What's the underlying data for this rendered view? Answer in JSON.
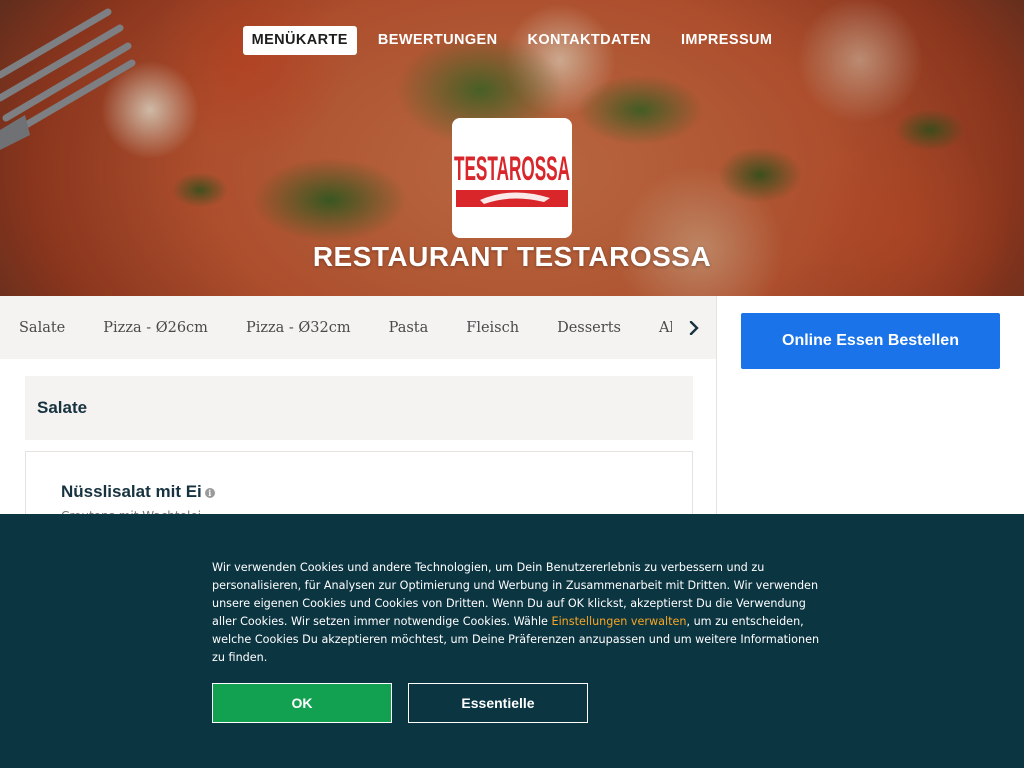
{
  "nav": {
    "items": [
      {
        "label": "MENÜKARTE",
        "active": true
      },
      {
        "label": "BEWERTUNGEN",
        "active": false
      },
      {
        "label": "KONTAKTDATEN",
        "active": false
      },
      {
        "label": "IMPRESSUM",
        "active": false
      }
    ]
  },
  "logo": {
    "text": "TESTAROSSA"
  },
  "restaurant": {
    "title": "RESTAURANT TESTAROSSA"
  },
  "categories": {
    "items": [
      "Salate",
      "Pizza - Ø26cm",
      "Pizza - Ø32cm",
      "Pasta",
      "Fleisch",
      "Desserts",
      "Alkoh"
    ],
    "next_icon": "chevron-right-icon"
  },
  "order": {
    "button_label": "Online Essen Bestellen"
  },
  "menu": {
    "section_title": "Salate",
    "item": {
      "name": "Nüsslisalat mit Ei",
      "description": "Croutons mit Wachtelei"
    }
  },
  "cookie": {
    "text_before": "Wir verwenden Cookies und andere Technologien, um Dein Benutzererlebnis zu verbessern und zu personalisieren, für Analysen zur Optimierung und Werbung in Zusammenarbeit mit Dritten. Wir verwenden unsere eigenen Cookies und Cookies von Dritten. Wenn Du auf OK klickst, akzeptierst Du die Verwendung aller Cookies. Wir setzen immer notwendige Cookies. Wähle ",
    "link_label": "Einstellungen verwalten",
    "text_after": ", um zu entscheiden, welche Cookies Du akzeptieren möchtest, um Deine Präferenzen anzupassen und um weitere Informationen zu finden.",
    "ok_label": "OK",
    "essential_label": "Essentielle"
  },
  "colors": {
    "order_button": "#1a73e8",
    "ok_button": "#12a150",
    "cookie_bg": "#0c3542",
    "link": "#f5a623"
  }
}
